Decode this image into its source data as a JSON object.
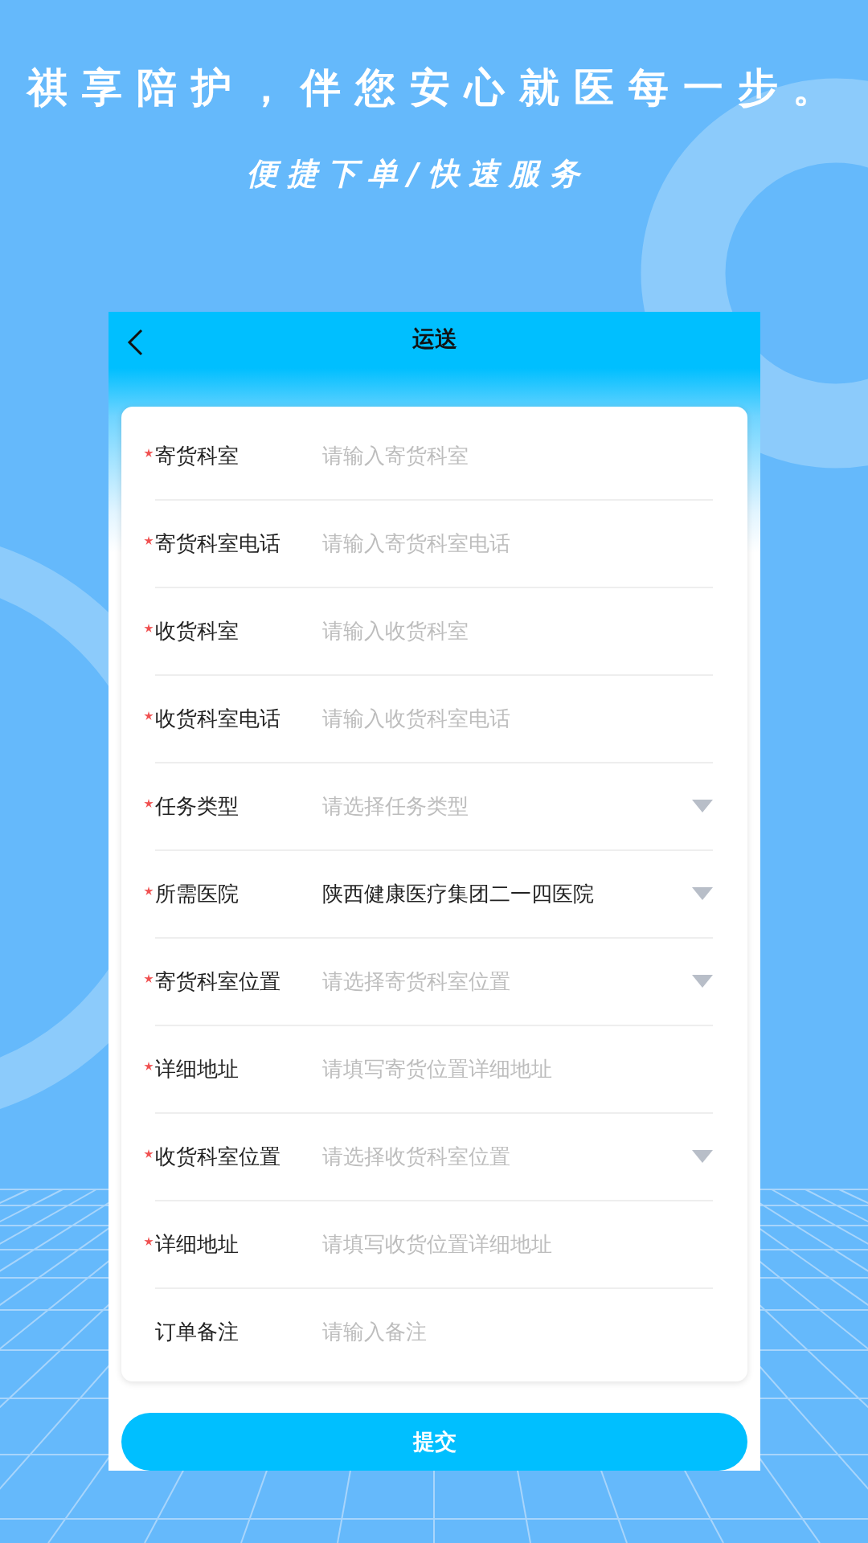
{
  "headline": "祺享陪护，伴您安心就医每一步。",
  "subtitle": "便捷下单/快速服务",
  "screen": {
    "title": "运送",
    "rows": [
      {
        "label": "寄货科室",
        "required": true,
        "kind": "input",
        "placeholder": "请输入寄货科室"
      },
      {
        "label": "寄货科室电话",
        "required": true,
        "kind": "input",
        "placeholder": "请输入寄货科室电话"
      },
      {
        "label": "收货科室",
        "required": true,
        "kind": "input",
        "placeholder": "请输入收货科室"
      },
      {
        "label": "收货科室电话",
        "required": true,
        "kind": "input",
        "placeholder": "请输入收货科室电话"
      },
      {
        "label": "任务类型",
        "required": true,
        "kind": "select",
        "placeholder": "请选择任务类型"
      },
      {
        "label": "所需医院",
        "required": true,
        "kind": "select",
        "value": "陕西健康医疗集团二一四医院"
      },
      {
        "label": "寄货科室位置",
        "required": true,
        "kind": "select",
        "placeholder": "请选择寄货科室位置"
      },
      {
        "label": "详细地址",
        "required": true,
        "kind": "input",
        "placeholder": "请填写寄货位置详细地址"
      },
      {
        "label": "收货科室位置",
        "required": true,
        "kind": "select",
        "placeholder": "请选择收货科室位置"
      },
      {
        "label": "详细地址",
        "required": true,
        "kind": "input",
        "placeholder": "请填写收货位置详细地址"
      },
      {
        "label": "订单备注",
        "required": false,
        "kind": "input",
        "placeholder": "请输入备注"
      }
    ],
    "submit": "提交"
  }
}
